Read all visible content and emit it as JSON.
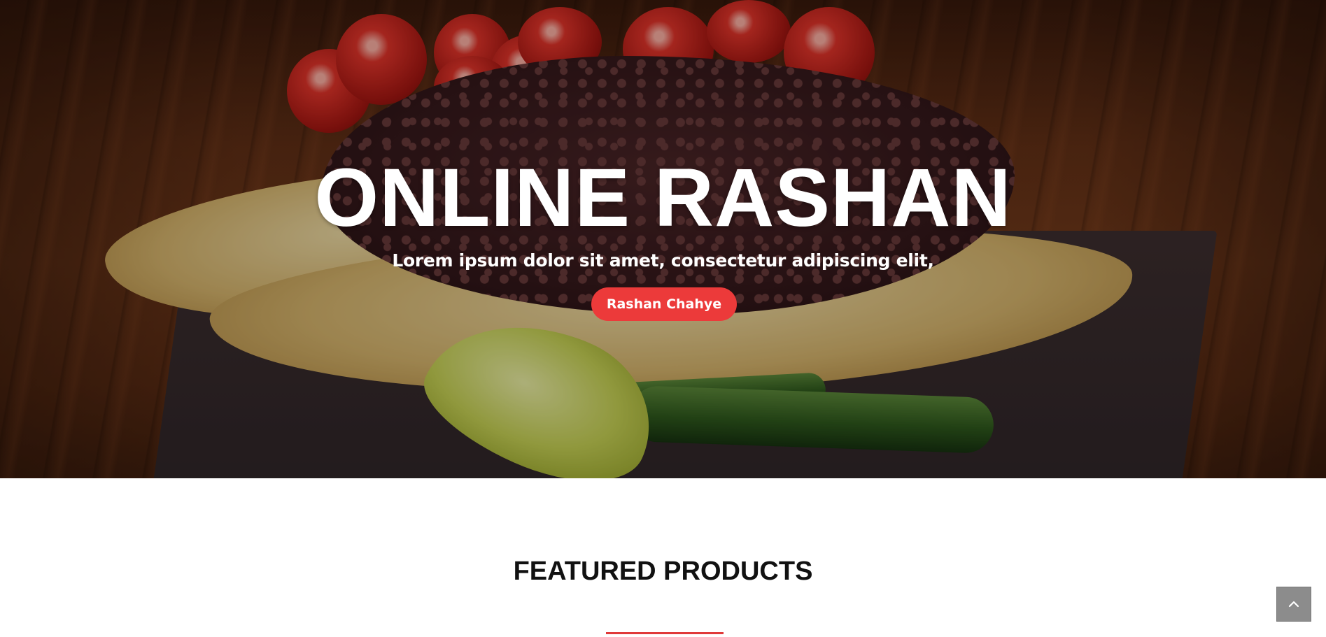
{
  "hero": {
    "title": "ONLINE RASHAN",
    "subtitle": "Lorem ipsum dolor sit amet, consectetur adipiscing elit,",
    "button_label": "Rashan Chahye"
  },
  "featured": {
    "title": "FEATURED PRODUCTS"
  },
  "back_to_top": {
    "icon": "chevron-up-icon"
  },
  "colors": {
    "accent": "#ec3a3a",
    "heading": "#111111",
    "back_to_top_bg": "#8c8c8c"
  }
}
